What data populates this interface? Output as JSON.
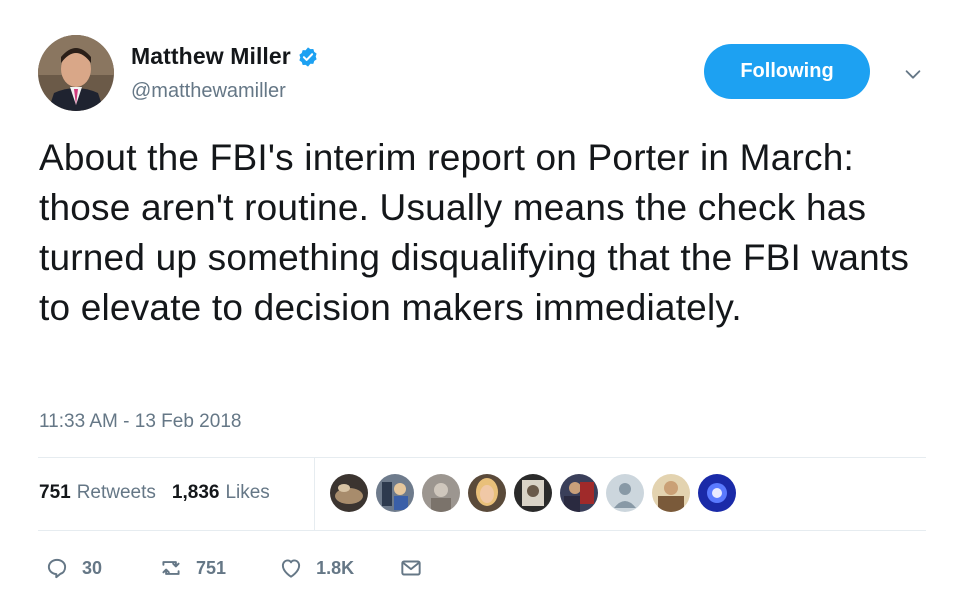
{
  "author": {
    "name": "Matthew Miller",
    "handle": "@matthewamiller",
    "verified": true
  },
  "follow_button_label": "Following",
  "tweet": {
    "text": "About the FBI's interim report on Porter in March: those aren't routine. Usually means the check has turned up something disqualifying that the FBI wants to elevate to decision makers immediately.",
    "timestamp": "11:33 AM - 13 Feb 2018"
  },
  "stats": {
    "retweets_count": "751",
    "retweets_label": "Retweets",
    "likes_count": "1,836",
    "likes_label": "Likes"
  },
  "liker_avatars": [
    "avatar",
    "avatar",
    "avatar",
    "avatar",
    "avatar",
    "avatar",
    "default-avatar",
    "avatar",
    "avatar"
  ],
  "actions": {
    "replies": "30",
    "retweets": "751",
    "likes": "1.8K"
  },
  "colors": {
    "brand_blue": "#1da1f2",
    "muted_gray": "#657786",
    "text_dark": "#14171a"
  },
  "icons": {
    "verified": "verified-badge-icon",
    "menu": "chevron-down-icon",
    "reply": "reply-icon",
    "retweet": "retweet-icon",
    "like": "heart-icon",
    "dm": "envelope-icon"
  }
}
